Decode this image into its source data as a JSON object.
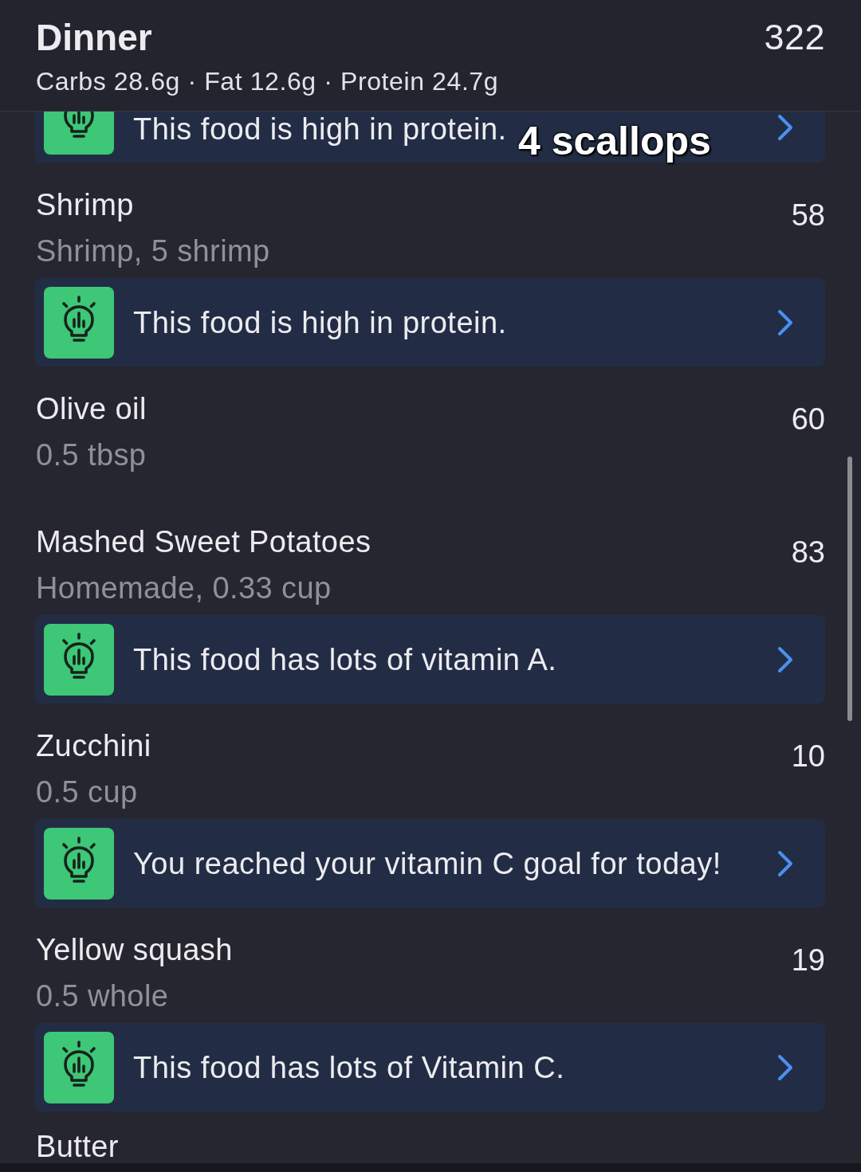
{
  "header": {
    "title": "Dinner",
    "macros": "Carbs 28.6g · Fat 12.6g · Protein 24.7g",
    "calories": "322"
  },
  "partial_tip": {
    "text": "This food is high in protein."
  },
  "caption": {
    "text": "4 scallops"
  },
  "foods": [
    {
      "name": "Shrimp",
      "serving": "Shrimp, 5 shrimp",
      "calories": "58",
      "tip": "This food is high in protein."
    },
    {
      "name": "Olive oil",
      "serving": "0.5 tbsp",
      "calories": "60"
    },
    {
      "name": "Mashed Sweet Potatoes",
      "serving": "Homemade, 0.33 cup",
      "calories": "83",
      "tip": "This food has lots of vitamin A."
    },
    {
      "name": "Zucchini",
      "serving": "0.5 cup",
      "calories": "10",
      "tip": "You reached your vitamin C goal for today!"
    },
    {
      "name": "Yellow squash",
      "serving": "0.5 whole",
      "calories": "19",
      "tip": "This food has lots of Vitamin C."
    },
    {
      "name": "Butter"
    }
  ]
}
